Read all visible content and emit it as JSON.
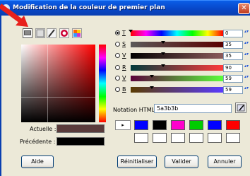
{
  "window": {
    "title": "Modification de la couleur de premier plan"
  },
  "toolbar": {
    "icons": [
      "screen-picker-icon",
      "scales-icon",
      "brush-icon",
      "color-wheel-icon",
      "palette-icon"
    ]
  },
  "swatches": {
    "current_label": "Actuelle :",
    "previous_label": "Précédente :",
    "current_color": "#5a3b3b",
    "previous_color": "#000000"
  },
  "channels": [
    {
      "label": "T",
      "value": "0",
      "checked": true,
      "fill": 0.0
    },
    {
      "label": "S",
      "value": "35",
      "checked": false,
      "fill": 0.35
    },
    {
      "label": "V",
      "value": "35",
      "checked": false,
      "fill": 0.35
    },
    {
      "label": "R",
      "value": "90",
      "checked": false,
      "fill": 0.35
    },
    {
      "label": "V",
      "value": "59",
      "checked": false,
      "fill": 0.23
    },
    {
      "label": "B",
      "value": "59",
      "checked": false,
      "fill": 0.23
    }
  ],
  "html_notation": {
    "label": "Notation HTML :",
    "value": "5a3b3b"
  },
  "history": [
    "#0000ff",
    "#000000",
    "#ff00cc",
    "#00cc00",
    "#0000ff",
    "#ff0000",
    "#ffffff",
    "#ffffff",
    "#ffffff",
    "#ffffff",
    "#ffffff",
    "#ffffff"
  ],
  "buttons": {
    "help": "Aide",
    "reset": "Réinitialiser",
    "ok": "Valider",
    "cancel": "Annuler"
  },
  "colors": {
    "accent": "#0a5ee8",
    "annotation_arrow": "#e8211c"
  }
}
